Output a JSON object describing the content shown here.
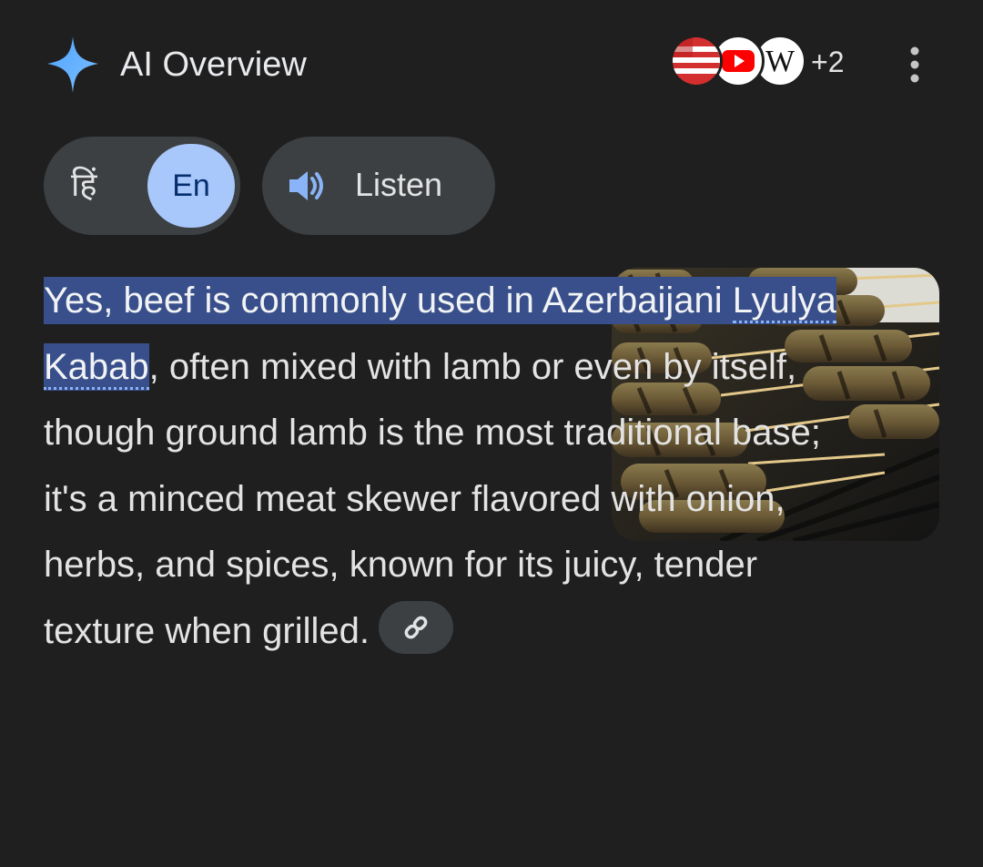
{
  "header": {
    "title": "AI Overview",
    "sparkle_icon": "sparkle-icon",
    "sources_more_count": "+2",
    "source_icons": [
      "flag-source-icon",
      "youtube-icon",
      "wikipedia-icon"
    ],
    "wikipedia_letter": "W",
    "more_icon": "more-vert-icon"
  },
  "controls": {
    "lang_hindi": "हिं",
    "lang_english": "En",
    "listen_label": "Listen",
    "listen_icon": "speaker-icon"
  },
  "answer": {
    "highlight_part1": "Yes, beef is commonly used in Azerbaijani ",
    "highlight_part2": "Lyulya Kabab",
    "rest_line": ", often mixed with lamb or even by itself, though ground lamb is the most traditional base; it's a minced meat skewer flavored with onion, herbs, and spices, known for its juicy, tender texture when grilled.",
    "link_icon": "link-icon"
  },
  "image": {
    "subject": "kabab-skewers-thumbnail"
  },
  "colors": {
    "background": "#1f1f1f",
    "chip": "#3c4043",
    "accent": "#a8c7fa",
    "highlight": "#394f8b"
  }
}
